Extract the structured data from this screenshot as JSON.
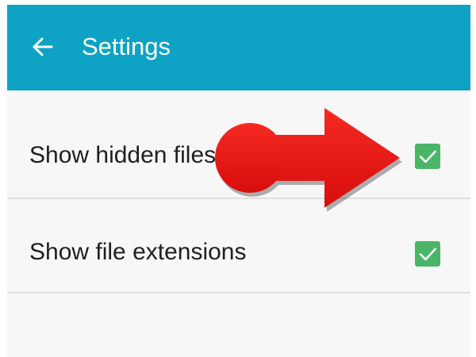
{
  "app_bar": {
    "title": "Settings",
    "back_icon": "arrow-left-icon",
    "color": "#0ea3c4"
  },
  "settings": [
    {
      "label": "Show hidden files",
      "checked": true
    },
    {
      "label": "Show file extensions",
      "checked": true
    }
  ],
  "checkbox_icon": "checkmark-icon",
  "checkbox_color": "#4bb567",
  "annotation": {
    "shape": "arrow",
    "direction": "right",
    "color": "#e81414",
    "points_to": "Show hidden files checkbox"
  }
}
